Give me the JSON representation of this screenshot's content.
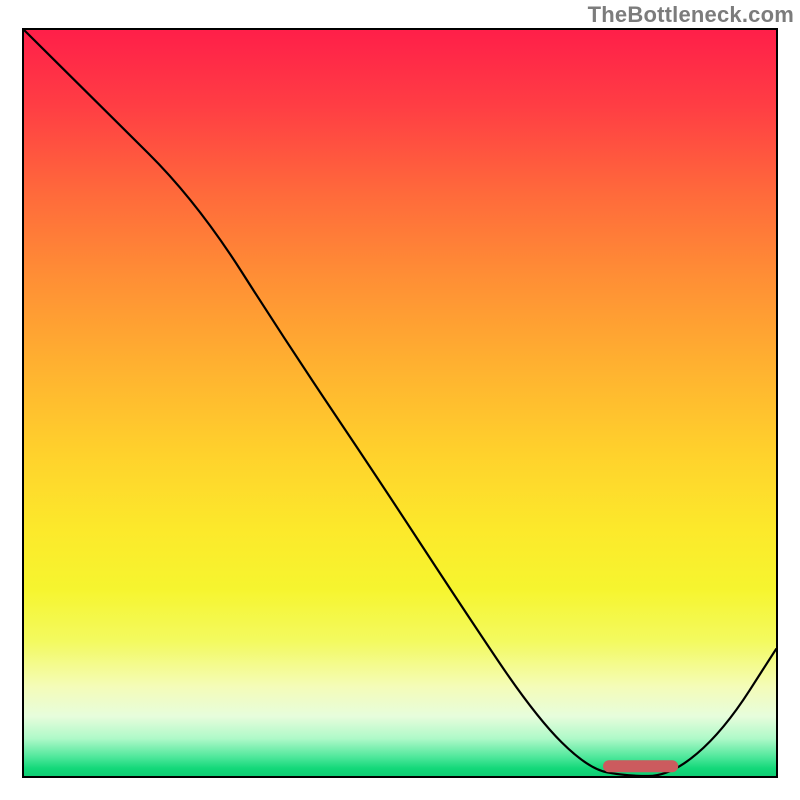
{
  "watermark": "TheBottleneck.com",
  "colors": {
    "gradient_top": "#ff1f49",
    "gradient_mid": "#ffd22c",
    "gradient_bottom": "#0fce74",
    "curve": "#000000",
    "marker": "#cc5b5e",
    "frame": "#000000",
    "watermark": "#7c7c7c"
  },
  "chart_data": {
    "type": "line",
    "title": "",
    "xlabel": "",
    "ylabel": "",
    "xlim": [
      0,
      1
    ],
    "ylim": [
      0,
      1
    ],
    "note": "No axis ticks or numeric labels are shown; x and y are normalized fractions of the plot area. Curve points were read visually.",
    "series": [
      {
        "name": "curve",
        "x": [
          0.0,
          0.1,
          0.23,
          0.35,
          0.47,
          0.58,
          0.68,
          0.75,
          0.8,
          0.86,
          0.93,
          1.0
        ],
        "y": [
          1.0,
          0.9,
          0.77,
          0.58,
          0.4,
          0.23,
          0.08,
          0.01,
          0.0,
          0.0,
          0.06,
          0.17
        ]
      }
    ],
    "annotations": [
      {
        "name": "optimal-marker",
        "shape": "rounded-bar",
        "x_range": [
          0.77,
          0.87
        ],
        "y": 0.005
      }
    ]
  }
}
